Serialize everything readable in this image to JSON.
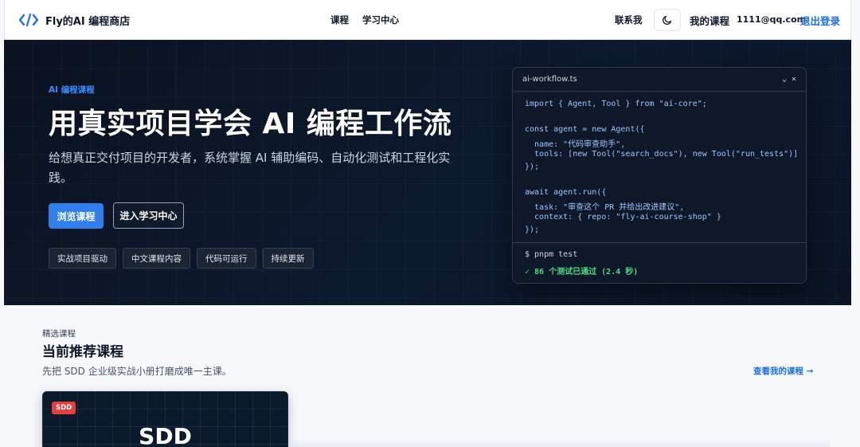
{
  "navbar": {
    "logo_text": "Fly的AI 编程商店",
    "links": [
      "课程",
      "学习中心"
    ],
    "contact": "联系我",
    "my_courses": "我的课程",
    "email": "1111@qq.com",
    "logout": "退出登录",
    "theme_icon": "moon-icon"
  },
  "hero": {
    "eyebrow": "AI 编程课程",
    "title": "用真实项目学会 AI 编程工作流",
    "subtitle": "给想真正交付项目的开发者，系统掌握 AI 辅助编码、自动化测试和工程化实践。",
    "primary_button": "浏览课程",
    "secondary_button": "进入学习中心",
    "tags": [
      "实战项目驱动",
      "中文课程内容",
      "代码可运行",
      "持续更新"
    ]
  },
  "code_card": {
    "filename": "ai-workflow.ts",
    "controls": "⌄ ×",
    "lines": [
      "import { Agent, Tool } from \"ai-core\";",
      "",
      "const agent = new Agent({",
      "  name: \"代码审查助手\",",
      "  tools: [new Tool(\"search_docs\"), new Tool(\"run_tests\")]",
      "});",
      "",
      "await agent.run({",
      "  task: \"审查这个 PR 并给出改进建议\",",
      "  context: { repo: \"fly-ai-course-shop\" }",
      "});"
    ],
    "terminal_cmd": "$ pnpm test",
    "terminal_result": "✓ 86 个测试已通过 (2.4 秒)"
  },
  "featured": {
    "eyebrow": "精选课程",
    "title": "当前推荐课程",
    "subtitle": "先把 SDD 企业级实战小册打磨成唯一主课。",
    "link": "查看我的课程 →",
    "card": {
      "badge": "SDD",
      "word": "SDD"
    }
  },
  "colors": {
    "accent": "#2f80ed",
    "link": "#1d6fe8",
    "hero_bg": "#0b1220",
    "success": "#4ade80",
    "badge": "#e53e3e"
  }
}
